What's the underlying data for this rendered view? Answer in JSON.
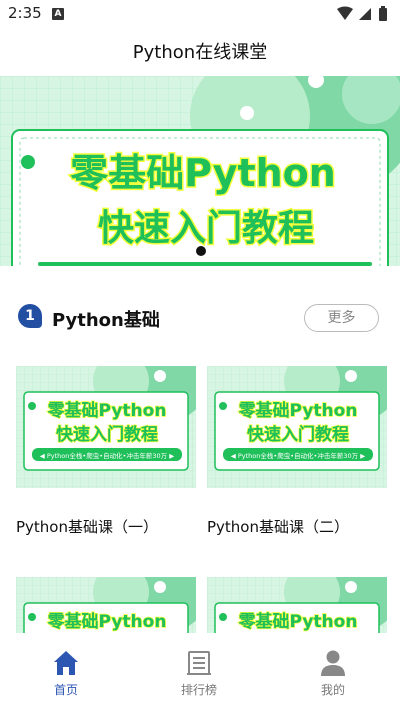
{
  "status_bar": {
    "time": "2:35",
    "notification_icon": "A"
  },
  "app_bar": {
    "title": "Python在线课堂"
  },
  "banner": {
    "line1": "零基础Python",
    "line2": "快速入门教程"
  },
  "section": {
    "number": "1",
    "title": "Python基础",
    "more_label": "更多"
  },
  "thumb_text": {
    "line1": "零基础Python",
    "line2": "快速入门教程",
    "tagline": "◀ Python全栈•爬虫•自动化•冲击年薪30万 ▶"
  },
  "courses": [
    {
      "title": "Python基础课（一）"
    },
    {
      "title": "Python基础课（二）"
    },
    {
      "title": ""
    },
    {
      "title": ""
    }
  ],
  "bottom_nav": {
    "items": [
      {
        "label": "首页",
        "icon": "home-icon",
        "active": true
      },
      {
        "label": "排行榜",
        "icon": "list-icon",
        "active": false
      },
      {
        "label": "我的",
        "icon": "person-icon",
        "active": false
      }
    ]
  },
  "colors": {
    "accent": "#2d56b3",
    "banner_green": "#a8e6c4",
    "title_green": "#1fbf5a",
    "title_yellow": "#f4ff3c"
  }
}
